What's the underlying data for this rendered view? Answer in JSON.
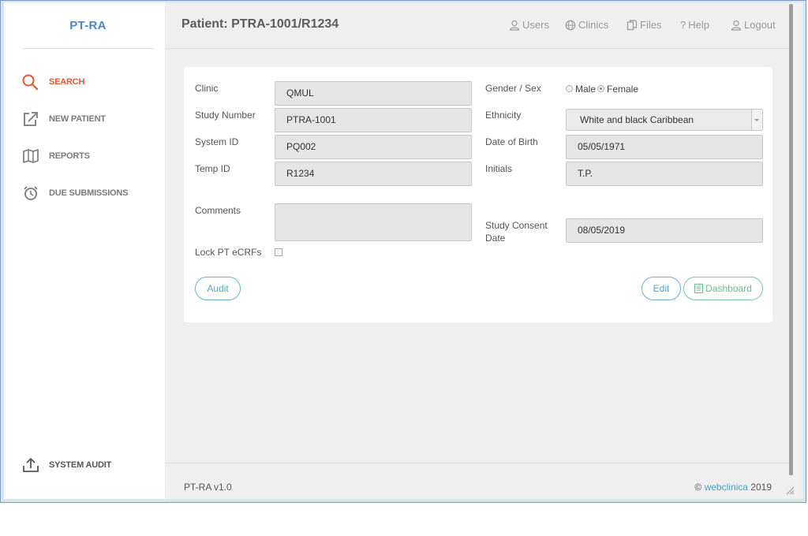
{
  "app": {
    "brand": "PT-RA"
  },
  "sidebar": {
    "items": [
      {
        "label": "SEARCH",
        "icon": "search-icon",
        "active": true
      },
      {
        "label": "NEW PATIENT",
        "icon": "external-link-icon",
        "active": false
      },
      {
        "label": "REPORTS",
        "icon": "map-icon",
        "active": false
      },
      {
        "label": "DUE SUBMISSIONS",
        "icon": "alarm-clock-icon",
        "active": false
      }
    ],
    "bottom_item": {
      "label": "SYSTEM AUDIT",
      "icon": "upload-icon"
    }
  },
  "header": {
    "title": "Patient: PTRA-1001/R1234",
    "nav": [
      {
        "label": "Users",
        "icon": "user-icon"
      },
      {
        "label": "Clinics",
        "icon": "globe-icon"
      },
      {
        "label": "Files",
        "icon": "files-icon"
      },
      {
        "label": "Help",
        "icon": "question-icon"
      },
      {
        "label": "Logout",
        "icon": "user-icon"
      }
    ]
  },
  "form": {
    "clinic": {
      "label": "Clinic",
      "value": "QMUL"
    },
    "study_number": {
      "label": "Study Number",
      "value": "PTRA-1001"
    },
    "system_id": {
      "label": "System ID",
      "value": "PQ002"
    },
    "temp_id": {
      "label": "Temp ID",
      "value": "R1234"
    },
    "comments": {
      "label": "Comments",
      "value": ""
    },
    "lock": {
      "label": "Lock PT eCRFs",
      "checked": false
    },
    "gender": {
      "label": "Gender / Sex",
      "options": [
        "Male",
        "Female"
      ],
      "selected": "Female"
    },
    "ethnicity": {
      "label": "Ethnicity",
      "value": "White and black Caribbean"
    },
    "dob": {
      "label": "Date of Birth",
      "value": "05/05/1971"
    },
    "initials": {
      "label": "Initials",
      "value": "T.P."
    },
    "consent": {
      "label_line1": "Study Consent",
      "label_line2": "Date",
      "value": "08/05/2019"
    }
  },
  "buttons": {
    "audit": "Audit",
    "edit": "Edit",
    "dashboard": "Dashboard"
  },
  "footer": {
    "version": "PT-RA v1.0",
    "copyright_symbol": "©",
    "link": "webclinica",
    "year": "2019"
  },
  "colors": {
    "accent": "#e8552f",
    "brand": "#4a86c8",
    "button_blue": "#5aa4ba",
    "button_green": "#6cbd8a"
  }
}
